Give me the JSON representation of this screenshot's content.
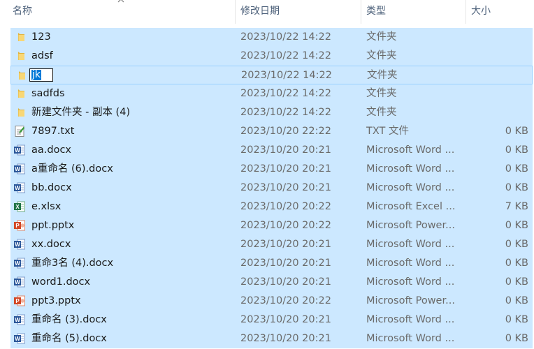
{
  "columns": {
    "name": "名称",
    "date": "修改日期",
    "type": "类型",
    "size": "大小"
  },
  "rows": [
    {
      "name": "123",
      "date": "2023/10/22 14:22",
      "type": "文件夹",
      "size": "",
      "icon": "folder-icon"
    },
    {
      "name": "adsf",
      "date": "2023/10/22 14:22",
      "type": "文件夹",
      "size": "",
      "icon": "folder-icon"
    },
    {
      "name": "jk",
      "date": "2023/10/22 14:22",
      "type": "文件夹",
      "size": "",
      "icon": "folder-icon",
      "editing": true
    },
    {
      "name": "sadfds",
      "date": "2023/10/22 14:22",
      "type": "文件夹",
      "size": "",
      "icon": "folder-icon"
    },
    {
      "name": "新建文件夹 - 副本 (4)",
      "date": "2023/10/22 14:22",
      "type": "文件夹",
      "size": "",
      "icon": "folder-icon"
    },
    {
      "name": "7897.txt",
      "date": "2023/10/20 22:22",
      "type": "TXT 文件",
      "size": "0 KB",
      "icon": "text-file-icon"
    },
    {
      "name": "aa.docx",
      "date": "2023/10/20 20:21",
      "type": "Microsoft Word ...",
      "size": "0 KB",
      "icon": "word-doc-icon"
    },
    {
      "name": "a重命名 (6).docx",
      "date": "2023/10/20 20:21",
      "type": "Microsoft Word ...",
      "size": "0 KB",
      "icon": "word-doc-icon"
    },
    {
      "name": "bb.docx",
      "date": "2023/10/20 20:21",
      "type": "Microsoft Word ...",
      "size": "0 KB",
      "icon": "word-doc-icon"
    },
    {
      "name": "e.xlsx",
      "date": "2023/10/20 20:22",
      "type": "Microsoft Excel ...",
      "size": "7 KB",
      "icon": "excel-sheet-icon"
    },
    {
      "name": "ppt.pptx",
      "date": "2023/10/20 20:22",
      "type": "Microsoft Power...",
      "size": "0 KB",
      "icon": "powerpoint-icon"
    },
    {
      "name": "xx.docx",
      "date": "2023/10/20 20:21",
      "type": "Microsoft Word ...",
      "size": "0 KB",
      "icon": "word-doc-icon"
    },
    {
      "name": "重命3名 (4).docx",
      "date": "2023/10/20 20:21",
      "type": "Microsoft Word ...",
      "size": "0 KB",
      "icon": "word-doc-icon"
    },
    {
      "name": "word1.docx",
      "date": "2023/10/20 20:21",
      "type": "Microsoft Word ...",
      "size": "0 KB",
      "icon": "word-doc-icon"
    },
    {
      "name": "ppt3.pptx",
      "date": "2023/10/20 20:22",
      "type": "Microsoft Power...",
      "size": "0 KB",
      "icon": "powerpoint-icon"
    },
    {
      "name": "重命名 (3).docx",
      "date": "2023/10/20 20:21",
      "type": "Microsoft Word ...",
      "size": "0 KB",
      "icon": "word-doc-icon"
    },
    {
      "name": "重命名 (5).docx",
      "date": "2023/10/20 20:21",
      "type": "Microsoft Word ...",
      "size": "0 KB",
      "icon": "word-doc-icon"
    }
  ],
  "colors": {
    "selection": "#cce8ff",
    "rename_highlight": "#0078d7",
    "header_text": "#4c607a",
    "folder": "#f8d775",
    "word": "#2b579a",
    "excel": "#217346",
    "powerpoint": "#d24726"
  }
}
